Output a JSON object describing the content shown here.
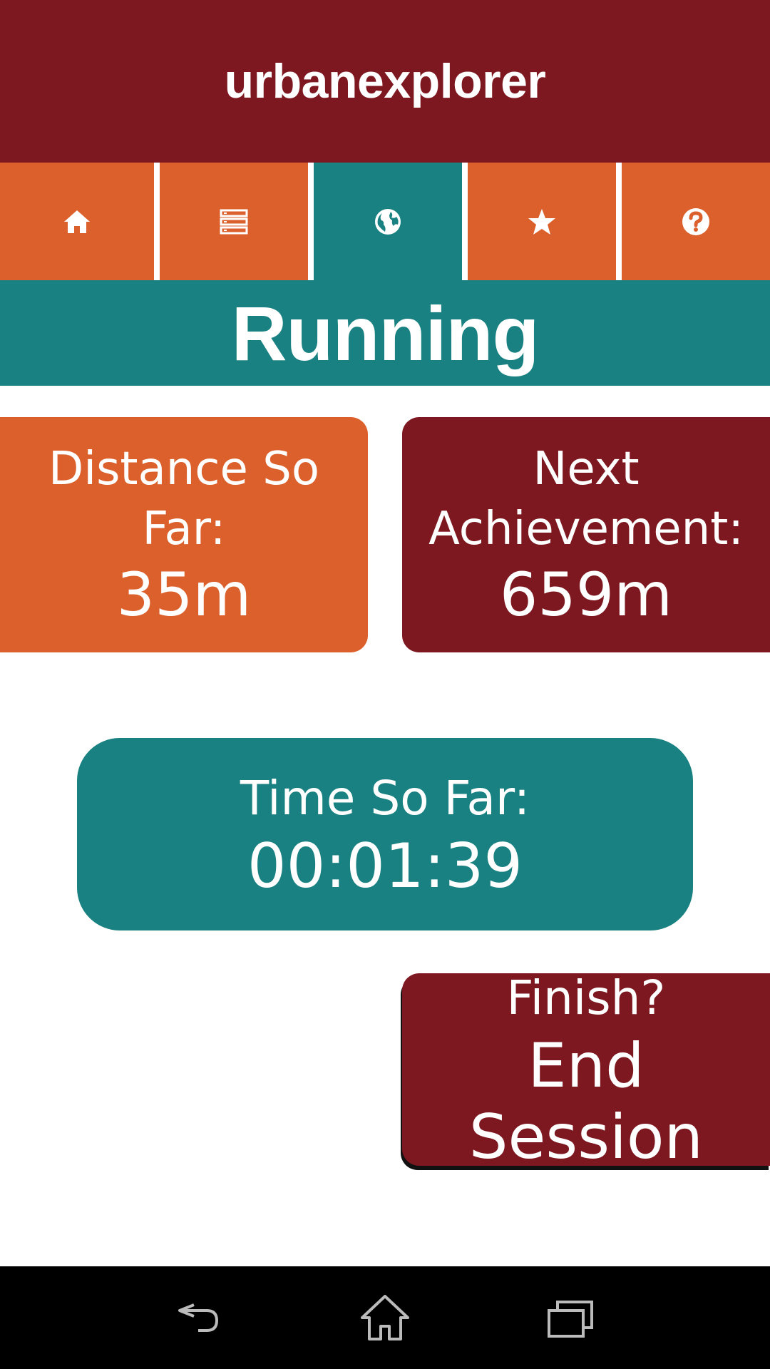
{
  "app": {
    "title": "urbanexplorer"
  },
  "tabs": [
    {
      "icon": "home-icon",
      "active": false
    },
    {
      "icon": "list-icon",
      "active": false
    },
    {
      "icon": "globe-icon",
      "active": true
    },
    {
      "icon": "star-icon",
      "active": false
    },
    {
      "icon": "help-icon",
      "active": false
    }
  ],
  "section": {
    "title": "Running"
  },
  "distance": {
    "label": "Distance So Far:",
    "value": "35m"
  },
  "achievement": {
    "label": "Next Achievement:",
    "value": "659m"
  },
  "time": {
    "label": "Time So Far:",
    "value": "00:01:39"
  },
  "finish": {
    "label": "Finish?",
    "action": "End Session"
  },
  "navbar": {
    "icons": [
      "back-icon",
      "home-icon",
      "recent-apps-icon"
    ]
  },
  "colors": {
    "maroon": "#7e1820",
    "orange": "#dc602c",
    "teal": "#198181"
  }
}
